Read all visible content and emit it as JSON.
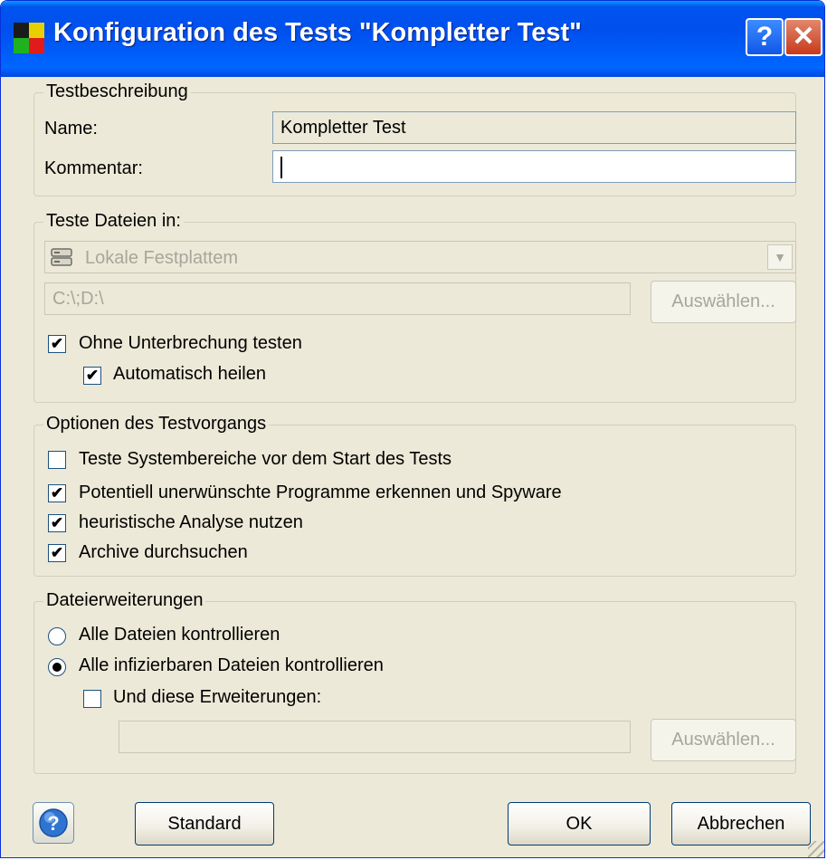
{
  "window": {
    "title": "Konfiguration des Tests \"Kompletter Test\"",
    "help_label": "?",
    "close_label": "✕"
  },
  "colors": {
    "titlebar": "#0055ea",
    "dialog_bg": "#ece9d8",
    "disabled_text": "#a7a69b"
  },
  "testbeschreibung": {
    "legend": "Testbeschreibung",
    "name_label": "Name:",
    "name_value": "Kompletter Test",
    "kommentar_label": "Kommentar:",
    "kommentar_value": ""
  },
  "teste_dateien": {
    "legend": "Teste Dateien in:",
    "dropdown_value": "Lokale Festplattem",
    "dropdown_icon": "hard-drive-icon",
    "path_value": "C:\\;D:\\",
    "select_button": "Auswählen...",
    "ohne_unterbrechung": {
      "label": "Ohne Unterbrechung testen",
      "checked": true
    },
    "automatisch_heilen": {
      "label": "Automatisch heilen",
      "checked": true
    }
  },
  "optionen": {
    "legend": "Optionen des Testvorgangs",
    "items": [
      {
        "label": "Teste Systembereiche vor dem Start des Tests",
        "checked": false
      },
      {
        "label": "Potentiell unerwünschte Programme erkennen und Spyware",
        "checked": true
      },
      {
        "label": "heuristische Analyse nutzen",
        "checked": true
      },
      {
        "label": "Archive durchsuchen",
        "checked": true
      }
    ]
  },
  "dateierweiterungen": {
    "legend": "Dateierweiterungen",
    "radio_all": {
      "label": "Alle Dateien kontrollieren",
      "selected": false
    },
    "radio_infectable": {
      "label": "Alle infizierbaren Dateien kontrollieren",
      "selected": true
    },
    "und_diese": {
      "label": "Und diese Erweiterungen:",
      "checked": false
    },
    "extensions_value": "",
    "select_button": "Auswählen..."
  },
  "footer": {
    "help_icon": "help-circle-icon",
    "standard": "Standard",
    "ok": "OK",
    "abbrechen": "Abbrechen"
  }
}
